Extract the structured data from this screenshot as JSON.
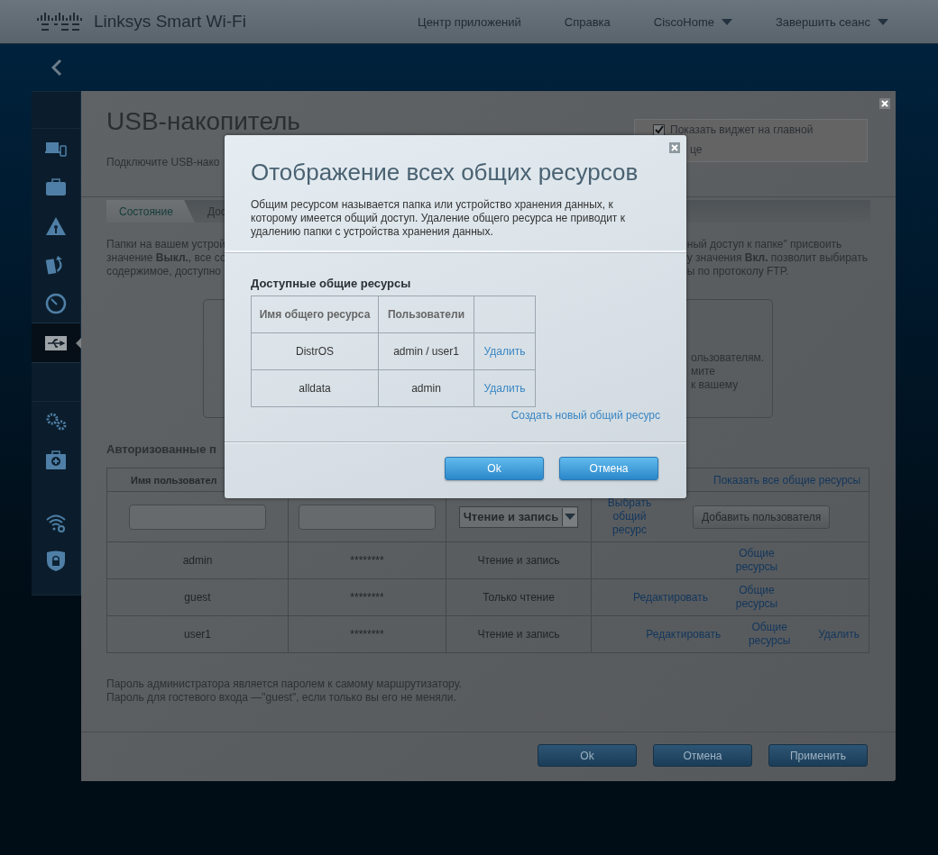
{
  "header": {
    "brand": "Linksys Smart Wi-Fi",
    "nav": [
      {
        "label": "Центр приложений",
        "dropdown": false
      },
      {
        "label": "Справка",
        "dropdown": false
      },
      {
        "label": "CiscoHome",
        "dropdown": true
      },
      {
        "label": "Завершить сеанс",
        "dropdown": true
      }
    ]
  },
  "sidebar": {
    "items": [
      {
        "kind": "devices",
        "selected": false
      },
      {
        "kind": "briefcase",
        "selected": false
      },
      {
        "kind": "warning",
        "selected": false
      },
      {
        "kind": "backup",
        "selected": false
      },
      {
        "kind": "gauge",
        "selected": false
      },
      {
        "kind": "usb",
        "selected": true
      },
      {
        "kind": "gears",
        "selected": false
      },
      {
        "kind": "medkit",
        "selected": false
      },
      {
        "kind": "wifi",
        "selected": false
      },
      {
        "kind": "shield",
        "selected": false
      }
    ]
  },
  "page": {
    "title": "USB-накопитель",
    "subtitle": "Подключите USB-нако",
    "widget": {
      "label": "Показать виджет на главной",
      "checked": true,
      "second_line": "це"
    },
    "tabs": [
      {
        "label": "Состояние",
        "selected": false
      },
      {
        "label": "Дос",
        "selected": true
      }
    ],
    "intro_left": [
      "Папки на вашем устрой",
      "значение **Выкл.**, все со",
      "содержимое, доступно"
    ],
    "intro_right": [
      "ный доступ к папке\" присвоить",
      "у значения **Вкл.** позволит выбирать",
      "ы по протоколу FTP."
    ],
    "info_box_lines": [
      "ользователям.",
      "мите",
      "к вашему"
    ],
    "users_heading": "Авторизованные п",
    "users_table": {
      "header": [
        "Имя пользовател",
        "Показать все общие ресурсы"
      ],
      "new_row": {
        "access": "Чтение и запись",
        "share_link": "Выбрать общий ресурс",
        "add_button": "Добавить пользователя"
      },
      "rows": [
        {
          "name": "admin",
          "password": "********",
          "access": "Чтение и запись",
          "shares": "Общие ресурсы"
        },
        {
          "name": "guest",
          "password": "********",
          "access": "Только чтение",
          "edit": "Редактировать",
          "shares": "Общие ресурсы"
        },
        {
          "name": "user1",
          "password": "********",
          "access": "Чтение и запись",
          "edit": "Редактировать",
          "shares": "Общие ресурсы",
          "delete": "Удалить"
        }
      ]
    },
    "notes": [
      "Пароль администратора является паролем к самому маршрутизатору.",
      "Пароль для гостевого входа —\"guest\", если только вы его не меняли."
    ],
    "buttons": [
      "Ok",
      "Отмена",
      "Применить"
    ]
  },
  "dialog": {
    "title": "Отображение всех общих ресурсов",
    "description": "Общим ресурсом называется папка или устройство хранения данных, к которому имеется общий доступ. Удаление общего ресурса не приводит к удалению папки с устройства хранения данных.",
    "section_title": "Доступные общие ресурсы",
    "columns": [
      "Имя общего ресурса",
      "Пользователи"
    ],
    "rows": [
      {
        "name": "DistrOS",
        "users": "admin / user1",
        "action": "Удалить"
      },
      {
        "name": "alldata",
        "users": "admin",
        "action": "Удалить"
      }
    ],
    "create_link": "Создать новый общий ресурс",
    "buttons": [
      "Ok",
      "Отмена"
    ]
  }
}
